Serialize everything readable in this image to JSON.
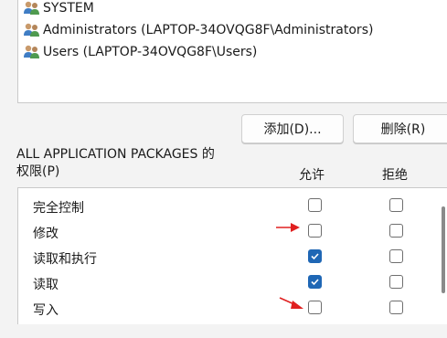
{
  "users": [
    {
      "label": "SYSTEM",
      "icon": "users-group-icon"
    },
    {
      "label": "Administrators (LAPTOP-34OVQG8F\\Administrators)",
      "icon": "users-group-icon"
    },
    {
      "label": "Users (LAPTOP-34OVQG8F\\Users)",
      "icon": "users-group-icon"
    }
  ],
  "buttons": {
    "add": "添加(D)...",
    "remove": "删除(R)"
  },
  "permissions": {
    "title_line1": "ALL APPLICATION PACKAGES 的",
    "title_line2": "权限(P)",
    "col_allow": "允许",
    "col_deny": "拒绝",
    "rows": [
      {
        "label": "完全控制",
        "allow": false,
        "deny": false
      },
      {
        "label": "修改",
        "allow": false,
        "deny": false
      },
      {
        "label": "读取和执行",
        "allow": true,
        "deny": false
      },
      {
        "label": "读取",
        "allow": true,
        "deny": false
      },
      {
        "label": "写入",
        "allow": false,
        "deny": false
      }
    ]
  },
  "colors": {
    "checked": "#1f67b5",
    "annotation_arrow": "#e02020"
  }
}
